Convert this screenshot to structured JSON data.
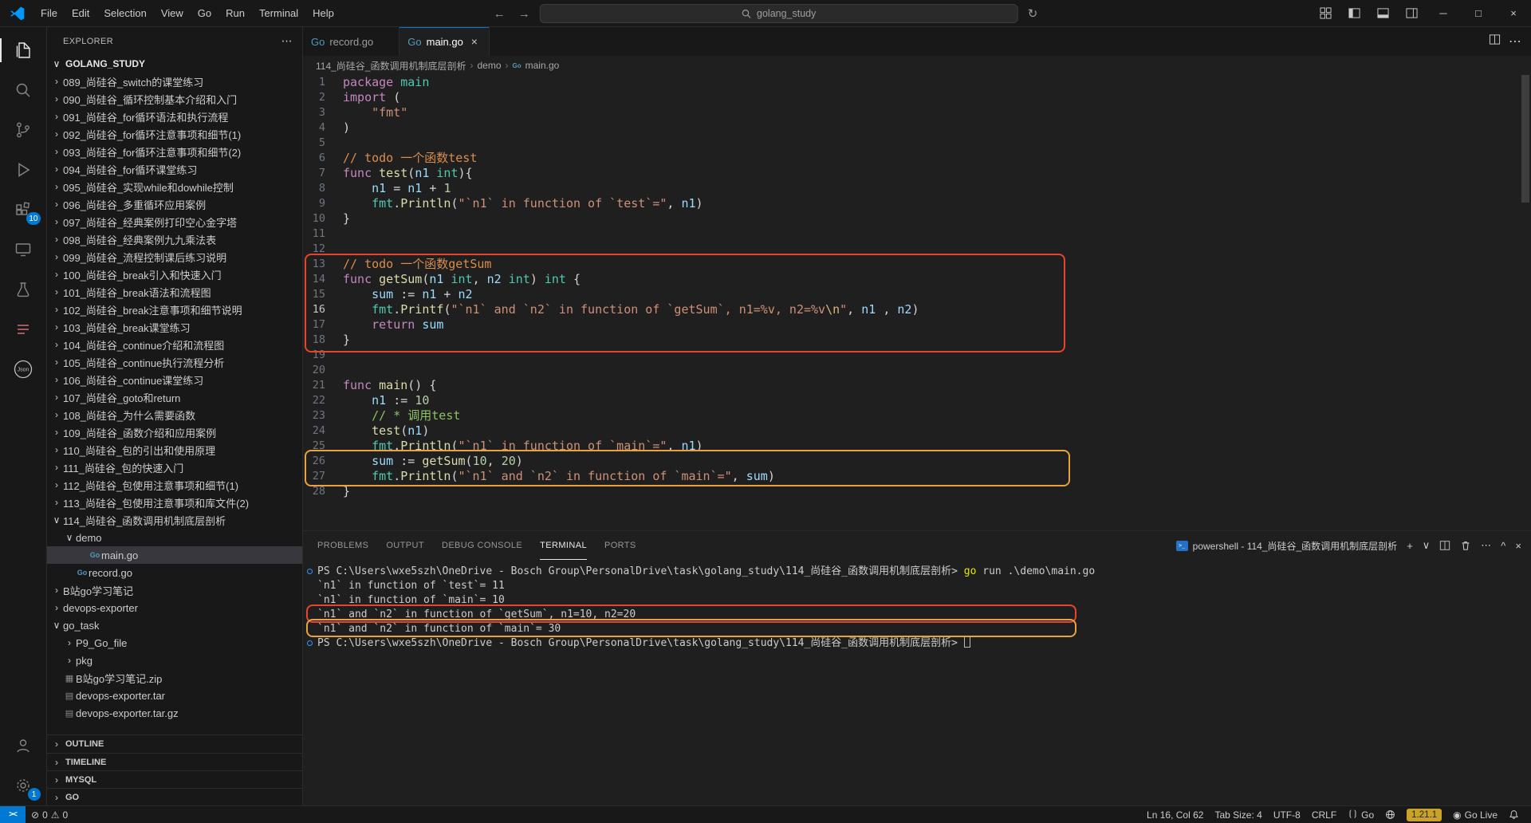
{
  "titlebar": {
    "menus": [
      "File",
      "Edit",
      "Selection",
      "View",
      "Go",
      "Run",
      "Terminal",
      "Help"
    ],
    "search_value": "golang_study"
  },
  "icons": {
    "back": "←",
    "forward": "→",
    "sync": "↻",
    "more": "⋯",
    "minimize": "─",
    "maximize": "□",
    "close": "×",
    "chevron_collapsed": "›",
    "chevron_expanded": "∨",
    "go_file": "Go",
    "generic_file": "▤",
    "zip_file": "▦",
    "plus": "+",
    "dropdown": "∨",
    "caret_up": "^",
    "error": "⊘",
    "warning": "⚠",
    "remote": "><",
    "broadcast": "◉"
  },
  "activitybar": {
    "items": [
      "explorer",
      "search",
      "source-control",
      "run-and-debug",
      "extensions",
      "remote-explorer",
      "testing",
      "project-manager",
      "json-tool"
    ],
    "badges": {
      "extensions": "10",
      "settings": "1"
    }
  },
  "sidebar": {
    "title": "EXPLORER",
    "root": "GOLANG_STUDY",
    "items": [
      {
        "label": "089_尚硅谷_switch的课堂练习",
        "indent": 1,
        "chev": "collapsed"
      },
      {
        "label": "090_尚硅谷_循环控制基本介绍和入门",
        "indent": 1,
        "chev": "collapsed"
      },
      {
        "label": "091_尚硅谷_for循环语法和执行流程",
        "indent": 1,
        "chev": "collapsed"
      },
      {
        "label": "092_尚硅谷_for循环注意事项和细节(1)",
        "indent": 1,
        "chev": "collapsed"
      },
      {
        "label": "093_尚硅谷_for循环注意事项和细节(2)",
        "indent": 1,
        "chev": "collapsed"
      },
      {
        "label": "094_尚硅谷_for循环课堂练习",
        "indent": 1,
        "chev": "collapsed"
      },
      {
        "label": "095_尚硅谷_实现while和dowhile控制",
        "indent": 1,
        "chev": "collapsed"
      },
      {
        "label": "096_尚硅谷_多重循环应用案例",
        "indent": 1,
        "chev": "collapsed"
      },
      {
        "label": "097_尚硅谷_经典案例打印空心金字塔",
        "indent": 1,
        "chev": "collapsed"
      },
      {
        "label": "098_尚硅谷_经典案例九九乘法表",
        "indent": 1,
        "chev": "collapsed"
      },
      {
        "label": "099_尚硅谷_流程控制课后练习说明",
        "indent": 1,
        "chev": "collapsed"
      },
      {
        "label": "100_尚硅谷_break引入和快速入门",
        "indent": 1,
        "chev": "collapsed"
      },
      {
        "label": "101_尚硅谷_break语法和流程图",
        "indent": 1,
        "chev": "collapsed"
      },
      {
        "label": "102_尚硅谷_break注意事项和细节说明",
        "indent": 1,
        "chev": "collapsed"
      },
      {
        "label": "103_尚硅谷_break课堂练习",
        "indent": 1,
        "chev": "collapsed"
      },
      {
        "label": "104_尚硅谷_continue介绍和流程图",
        "indent": 1,
        "chev": "collapsed"
      },
      {
        "label": "105_尚硅谷_continue执行流程分析",
        "indent": 1,
        "chev": "collapsed"
      },
      {
        "label": "106_尚硅谷_continue课堂练习",
        "indent": 1,
        "chev": "collapsed"
      },
      {
        "label": "107_尚硅谷_goto和return",
        "indent": 1,
        "chev": "collapsed"
      },
      {
        "label": "108_尚硅谷_为什么需要函数",
        "indent": 1,
        "chev": "collapsed"
      },
      {
        "label": "109_尚硅谷_函数介绍和应用案例",
        "indent": 1,
        "chev": "collapsed"
      },
      {
        "label": "110_尚硅谷_包的引出和使用原理",
        "indent": 1,
        "chev": "collapsed"
      },
      {
        "label": "111_尚硅谷_包的快速入门",
        "indent": 1,
        "chev": "collapsed"
      },
      {
        "label": "112_尚硅谷_包使用注意事项和细节(1)",
        "indent": 1,
        "chev": "collapsed"
      },
      {
        "label": "113_尚硅谷_包使用注意事项和库文件(2)",
        "indent": 1,
        "chev": "collapsed"
      },
      {
        "label": "114_尚硅谷_函数调用机制底层剖析",
        "indent": 1,
        "chev": "expanded"
      },
      {
        "label": "demo",
        "indent": 2,
        "chev": "expanded"
      },
      {
        "label": "main.go",
        "indent": 3,
        "icon": "go",
        "selected": true
      },
      {
        "label": "record.go",
        "indent": 2,
        "icon": "go"
      },
      {
        "label": "B站go学习笔记",
        "indent": 1,
        "chev": "collapsed"
      },
      {
        "label": "devops-exporter",
        "indent": 1,
        "chev": "collapsed"
      },
      {
        "label": "go_task",
        "indent": 1,
        "chev": "expanded"
      },
      {
        "label": "P9_Go_file",
        "indent": 2,
        "chev": "collapsed"
      },
      {
        "label": "pkg",
        "indent": 2,
        "chev": "collapsed"
      },
      {
        "label": "B站go学习笔记.zip",
        "indent": 1,
        "icon": "zip"
      },
      {
        "label": "devops-exporter.tar",
        "indent": 1,
        "icon": "file"
      },
      {
        "label": "devops-exporter.tar.gz",
        "indent": 1,
        "icon": "file"
      }
    ],
    "bottom_sections": [
      "OUTLINE",
      "TIMELINE",
      "MYSQL",
      "GO"
    ]
  },
  "tabs": [
    {
      "label": "record.go",
      "active": false
    },
    {
      "label": "main.go",
      "active": true
    }
  ],
  "breadcrumb": [
    "114_尚硅谷_函数调用机制底层剖析",
    "demo",
    "main.go"
  ],
  "editor": {
    "active_line": 16,
    "lines": [
      [
        [
          "k",
          "package"
        ],
        [
          "d",
          " "
        ],
        [
          "t",
          "main"
        ]
      ],
      [
        [
          "k",
          "import"
        ],
        [
          "d",
          " ("
        ]
      ],
      [
        [
          "d",
          "    "
        ],
        [
          "s",
          "\"fmt\""
        ]
      ],
      [
        [
          "d",
          ")"
        ]
      ],
      [],
      [
        [
          "ct",
          "// todo 一个函数test"
        ]
      ],
      [
        [
          "k",
          "func"
        ],
        [
          "d",
          " "
        ],
        [
          "f",
          "test"
        ],
        [
          "d",
          "("
        ],
        [
          "v",
          "n1"
        ],
        [
          "d",
          " "
        ],
        [
          "t",
          "int"
        ],
        [
          "d",
          "){"
        ]
      ],
      [
        [
          "d",
          "    "
        ],
        [
          "v",
          "n1"
        ],
        [
          "d",
          " = "
        ],
        [
          "v",
          "n1"
        ],
        [
          "d",
          " + "
        ],
        [
          "n",
          "1"
        ]
      ],
      [
        [
          "d",
          "    "
        ],
        [
          "t",
          "fmt"
        ],
        [
          "d",
          "."
        ],
        [
          "f",
          "Println"
        ],
        [
          "d",
          "("
        ],
        [
          "s",
          "\"`n1` in function of `test`=\""
        ],
        [
          "d",
          ", "
        ],
        [
          "v",
          "n1"
        ],
        [
          "d",
          ")"
        ]
      ],
      [
        [
          "d",
          "}"
        ]
      ],
      [],
      [],
      [
        [
          "ct",
          "// todo 一个函数getSum"
        ]
      ],
      [
        [
          "k",
          "func"
        ],
        [
          "d",
          " "
        ],
        [
          "f",
          "getSum"
        ],
        [
          "d",
          "("
        ],
        [
          "v",
          "n1"
        ],
        [
          "d",
          " "
        ],
        [
          "t",
          "int"
        ],
        [
          "d",
          ", "
        ],
        [
          "v",
          "n2"
        ],
        [
          "d",
          " "
        ],
        [
          "t",
          "int"
        ],
        [
          "d",
          ") "
        ],
        [
          "t",
          "int"
        ],
        [
          "d",
          " {"
        ]
      ],
      [
        [
          "d",
          "    "
        ],
        [
          "v",
          "sum"
        ],
        [
          "d",
          " := "
        ],
        [
          "v",
          "n1"
        ],
        [
          "d",
          " + "
        ],
        [
          "v",
          "n2"
        ]
      ],
      [
        [
          "d",
          "    "
        ],
        [
          "t",
          "fmt"
        ],
        [
          "d",
          "."
        ],
        [
          "f",
          "Printf"
        ],
        [
          "d",
          "("
        ],
        [
          "s",
          "\"`n1` and `n2` in function of `getSum`, n1=%v, n2=%v"
        ],
        [
          "e",
          "\\n"
        ],
        [
          "s",
          "\""
        ],
        [
          "d",
          ", "
        ],
        [
          "v",
          "n1"
        ],
        [
          "d",
          " , "
        ],
        [
          "v",
          "n2"
        ],
        [
          "d",
          ")"
        ]
      ],
      [
        [
          "d",
          "    "
        ],
        [
          "k",
          "return"
        ],
        [
          "d",
          " "
        ],
        [
          "v",
          "sum"
        ]
      ],
      [
        [
          "d",
          "}"
        ]
      ],
      [],
      [],
      [
        [
          "k",
          "func"
        ],
        [
          "d",
          " "
        ],
        [
          "f",
          "main"
        ],
        [
          "d",
          "() {"
        ]
      ],
      [
        [
          "d",
          "    "
        ],
        [
          "v",
          "n1"
        ],
        [
          "d",
          " := "
        ],
        [
          "n",
          "10"
        ]
      ],
      [
        [
          "d",
          "    "
        ],
        [
          "cs",
          "// * 调用test"
        ]
      ],
      [
        [
          "d",
          "    "
        ],
        [
          "f",
          "test"
        ],
        [
          "d",
          "("
        ],
        [
          "v",
          "n1"
        ],
        [
          "d",
          ")"
        ]
      ],
      [
        [
          "d",
          "    "
        ],
        [
          "t",
          "fmt"
        ],
        [
          "d",
          "."
        ],
        [
          "f",
          "Println"
        ],
        [
          "d",
          "("
        ],
        [
          "s",
          "\"`n1` in function of `main`=\""
        ],
        [
          "d",
          ", "
        ],
        [
          "v",
          "n1"
        ],
        [
          "d",
          ")"
        ]
      ],
      [
        [
          "d",
          "    "
        ],
        [
          "v",
          "sum"
        ],
        [
          "d",
          " := "
        ],
        [
          "f",
          "getSum"
        ],
        [
          "d",
          "("
        ],
        [
          "n",
          "10"
        ],
        [
          "d",
          ", "
        ],
        [
          "n",
          "20"
        ],
        [
          "d",
          ")"
        ]
      ],
      [
        [
          "d",
          "    "
        ],
        [
          "t",
          "fmt"
        ],
        [
          "d",
          "."
        ],
        [
          "f",
          "Println"
        ],
        [
          "d",
          "("
        ],
        [
          "s",
          "\"`n1` and `n2` in function of `main`=\""
        ],
        [
          "d",
          ", "
        ],
        [
          "v",
          "sum"
        ],
        [
          "d",
          ")"
        ]
      ],
      [
        [
          "d",
          "}"
        ]
      ]
    ]
  },
  "panel": {
    "tabs": [
      "PROBLEMS",
      "OUTPUT",
      "DEBUG CONSOLE",
      "TERMINAL",
      "PORTS"
    ],
    "active_tab": "TERMINAL",
    "terminal_title": "powershell - 114_尚硅谷_函数调用机制底层剖析",
    "terminal_lines": [
      {
        "dot": true,
        "tokens": [
          [
            "w",
            "PS C:\\Users\\wxe5szh\\OneDrive - Bosch Group\\PersonalDrive\\task\\golang_study\\114_尚硅谷_函数调用机制底层剖析> "
          ],
          [
            "y",
            "go"
          ],
          [
            "w",
            " run .\\demo\\main.go"
          ]
        ]
      },
      {
        "dot": false,
        "tokens": [
          [
            "w",
            "`n1` in function of `test`= 11"
          ]
        ]
      },
      {
        "dot": false,
        "tokens": [
          [
            "w",
            "`n1` in function of `main`= 10"
          ]
        ]
      },
      {
        "dot": false,
        "tokens": [
          [
            "w",
            "`n1` and `n2` in function of `getSum`, n1=10, n2=20"
          ]
        ]
      },
      {
        "dot": false,
        "tokens": [
          [
            "w",
            "`n1` and `n2` in function of `main`= 30"
          ]
        ]
      },
      {
        "dot": true,
        "tokens": [
          [
            "w",
            "PS C:\\Users\\wxe5szh\\OneDrive - Bosch Group\\PersonalDrive\\task\\golang_study\\114_尚硅谷_函数调用机制底层剖析> "
          ],
          [
            "cur",
            ""
          ]
        ]
      }
    ]
  },
  "statusbar": {
    "errors": "0",
    "warnings": "0",
    "line_col": "Ln 16, Col 62",
    "tab_size": "Tab Size: 4",
    "encoding": "UTF-8",
    "eol": "CRLF",
    "language": "Go",
    "go_version": "1.21.1",
    "go_live": "Go Live"
  },
  "annotations": {
    "red_color": "#E8442C",
    "orange_color": "#E8A33E",
    "editor_red_marks_lines": "13-18",
    "editor_orange_marks_lines": "26-27",
    "terminal_red_marks_line": "`n1` and `n2` in function of `getSum`, n1=10, n2=20",
    "terminal_orange_marks_line": "`n1` and `n2` in function of `main`= 30"
  }
}
